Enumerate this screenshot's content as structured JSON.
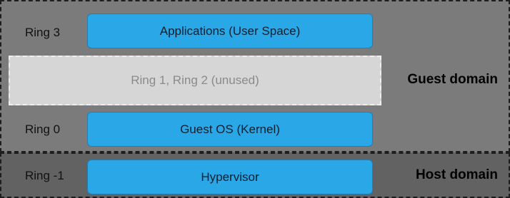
{
  "rings": {
    "ring3": "Ring 3",
    "ring0": "Ring 0",
    "ring_minus1": "Ring -1",
    "unused": "Ring 1, Ring 2 (unused)"
  },
  "layers": {
    "applications": "Applications (User Space)",
    "guest_os": "Guest OS (Kernel)",
    "hypervisor": "Hypervisor"
  },
  "domains": {
    "guest": "Guest domain",
    "host": "Host domain"
  },
  "colors": {
    "guest_bg": "#7b7b7b",
    "host_bg": "#626262",
    "unused_bg": "#d6d6d6",
    "layer_fill": "#2aa7e6",
    "layer_border": "#1f7eb5"
  }
}
